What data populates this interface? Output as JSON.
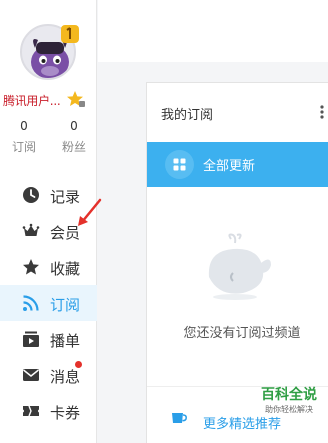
{
  "user": {
    "name": "腾讯用户...",
    "stats": [
      {
        "value": "0",
        "label": "订阅"
      },
      {
        "value": "0",
        "label": "粉丝"
      }
    ]
  },
  "nav": {
    "items": [
      {
        "label": "记录",
        "icon": "clock-icon"
      },
      {
        "label": "会员",
        "icon": "crown-icon"
      },
      {
        "label": "收藏",
        "icon": "star-icon"
      },
      {
        "label": "订阅",
        "icon": "rss-icon",
        "active": true
      },
      {
        "label": "播单",
        "icon": "playlist-icon"
      },
      {
        "label": "消息",
        "icon": "mail-icon",
        "badge": true
      },
      {
        "label": "卡券",
        "icon": "ticket-icon"
      }
    ]
  },
  "subscriptions": {
    "title": "我的订阅",
    "update_all": "全部更新",
    "empty_message": "您还没有订阅过频道",
    "more_link": "更多精选推荐"
  },
  "watermark": {
    "title": "百科全说",
    "subtitle": "助你轻松解决"
  },
  "colors": {
    "accent": "#3cb0ef",
    "active_text": "#2a9ee8",
    "username": "#c9202c",
    "badge": "#e4312b"
  }
}
